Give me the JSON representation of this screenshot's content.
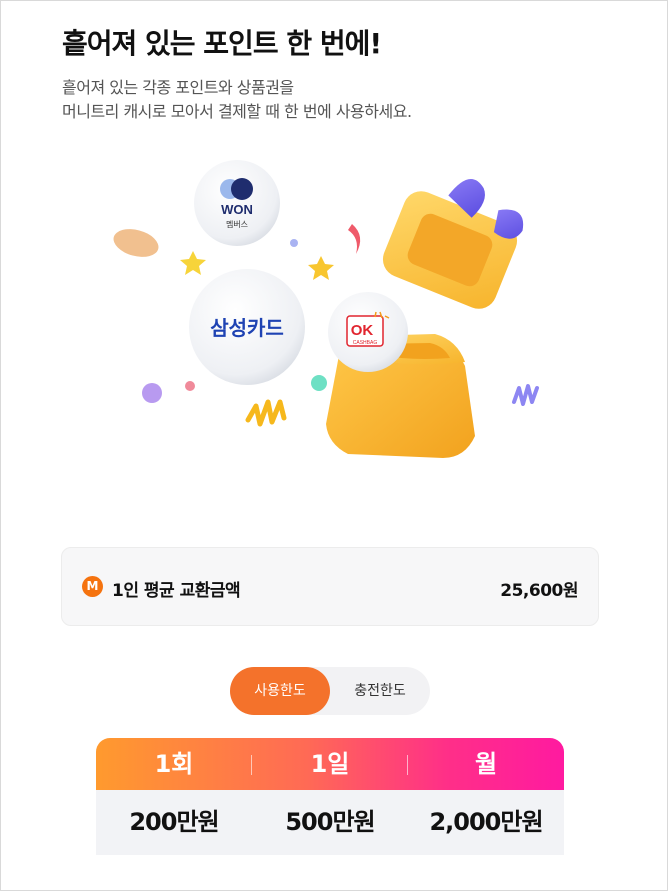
{
  "header": {
    "title": "흩어져 있는 포인트 한 번에!",
    "desc_line1": "흩어져 있는 각종 포인트와 상품권을",
    "desc_line2": "머니트리 캐시로 모아서 결제할 때 한 번에 사용하세요."
  },
  "hero": {
    "won_title": "WON",
    "won_sub": "멤버스",
    "samsung": "삼성카드",
    "ok": "OK",
    "ok_sub": "CASHBAG"
  },
  "average": {
    "badge": "M",
    "label": "1인 평균 교환금액",
    "value": "25,600원"
  },
  "toggle": {
    "active_label": "사용한도",
    "inactive_label": "충전한도"
  },
  "limits": {
    "headers": [
      "1회",
      "1일",
      "월"
    ],
    "values": [
      "200만원",
      "500만원",
      "2,000만원"
    ]
  },
  "colors": {
    "accent": "#f4722b",
    "gradient_start": "#ff9a2e",
    "gradient_end": "#ff1aa0"
  }
}
